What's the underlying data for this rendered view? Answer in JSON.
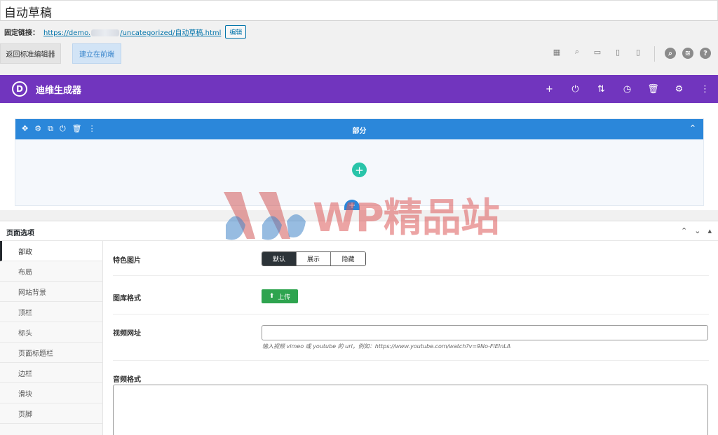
{
  "header": {
    "title": "自动草稿",
    "permalink_label": "固定链接：",
    "permalink_url_start": "https://demo.",
    "permalink_url_end": "/uncategorized/自动草稿.html",
    "edit_button": "编辑",
    "back_button": "返回标准编辑器",
    "frontend_button": "建立在前端"
  },
  "divi": {
    "logo": "D",
    "title": "迪维生成器",
    "section_title": "部分"
  },
  "page_options": {
    "title": "页面选项",
    "tabs": [
      "部政",
      "布局",
      "网站背景",
      "顶栏",
      "标头",
      "页面标题栏",
      "边栏",
      "滑块",
      "页脚"
    ],
    "featured_image_label": "特色图片",
    "featured_options": [
      "默认",
      "展示",
      "隐藏"
    ],
    "gallery_label": "图库格式",
    "upload_button": "上传",
    "video_label": "视频网址",
    "video_hint": "输入视频 vimeo 或 youtube 的 url。例如：https://www.youtube.com/watch?v=9No-FiEInLA",
    "audio_label": "音频格式"
  },
  "watermark": "WP精品站",
  "colors": {
    "divi_purple": "#7135be",
    "section_blue": "#2b87da",
    "add_green": "#29c4a9",
    "upload_green": "#2ea44f"
  }
}
